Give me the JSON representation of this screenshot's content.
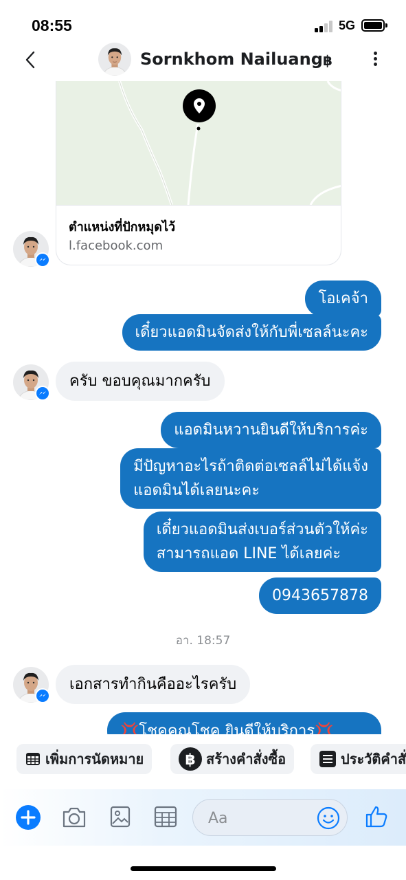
{
  "status_bar": {
    "time": "08:55",
    "network": "5G"
  },
  "header": {
    "contact_name": "Sornkhom Nailuang",
    "baht_symbol": "฿"
  },
  "map_card": {
    "title": "ตำแหน่งที่ปักหมุดไว้",
    "domain": "l.facebook.com"
  },
  "messages": {
    "out_1": "โอเคจ้า",
    "out_2": "เดี๋ยวแอดมินจัดส่งให้กับพี่เซลล์นะคะ",
    "in_1": "ครับ ขอบคุณมากครับ",
    "out_3": "แอดมินหวานยินดีให้บริการค่ะ",
    "out_4_line1": "มีปัญหาอะไรถ้าติดต่อเซลล์ไม่ได้แจ้ง",
    "out_4_line2": "แอดมินได้เลยนะคะ",
    "out_5_line1": "เดี๋ยวแอดมินส่งเบอร์ส่วนตัวให้ค่ะ",
    "out_5_line2": "สามารถแอด LINE ได้เลยค่ะ",
    "out_6": "0943657878",
    "time_divider": "อา. 18:57",
    "in_2": "เอกสารทำกินคืออะไรครับ",
    "out_7_partial": "💢โชคคูณโชค ยินดีให้บริการ💢"
  },
  "quick_actions": {
    "appointment": "เพิ่มการนัดหมาย",
    "create_order": "สร้างคำสั่งซื้อ",
    "order_history": "ประวัติคำสั่ง"
  },
  "composer": {
    "placeholder": "Aa"
  },
  "colors": {
    "outgoing_bubble": "#1674c1",
    "incoming_bubble": "#f0f2f5",
    "accent": "#0a7cff"
  }
}
